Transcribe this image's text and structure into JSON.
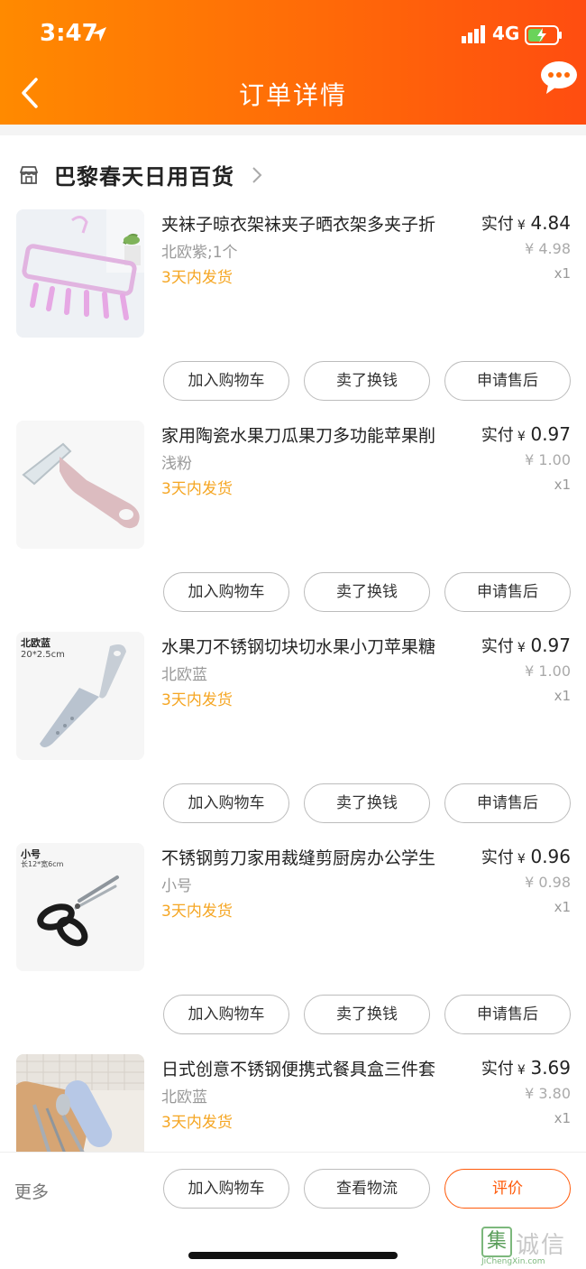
{
  "status_bar": {
    "time": "3:47",
    "network": "4G"
  },
  "header": {
    "title": "订单详情"
  },
  "shop": {
    "name": "巴黎春天日用百货"
  },
  "price_label": "实付",
  "currency": "¥",
  "items": [
    {
      "name": "夹袜子晾衣架袜夹子晒衣架多夹子折",
      "sku": "北欧紫;1个",
      "shipping": "3天内发货",
      "paid": "4.84",
      "original": "4.98",
      "qty": "x1",
      "actions": [
        "加入购物车",
        "卖了换钱",
        "申请售后"
      ]
    },
    {
      "name": "家用陶瓷水果刀瓜果刀多功能苹果削",
      "sku": "浅粉",
      "shipping": "3天内发货",
      "paid": "0.97",
      "original": "1.00",
      "qty": "x1",
      "actions": [
        "加入购物车",
        "卖了换钱",
        "申请售后"
      ]
    },
    {
      "name": "水果刀不锈钢切块切水果小刀苹果糖",
      "sku": "北欧蓝",
      "shipping": "3天内发货",
      "paid": "0.97",
      "original": "1.00",
      "qty": "x1",
      "image_label": "北欧蓝",
      "image_sub": "20*2.5cm",
      "actions": [
        "加入购物车",
        "卖了换钱",
        "申请售后"
      ]
    },
    {
      "name": "不锈钢剪刀家用裁缝剪厨房办公学生",
      "sku": "小号",
      "shipping": "3天内发货",
      "paid": "0.96",
      "original": "0.98",
      "qty": "x1",
      "image_label": "小号",
      "image_sub": "长12*宽6cm",
      "actions": [
        "加入购物车",
        "卖了换钱",
        "申请售后"
      ]
    },
    {
      "name": "日式创意不锈钢便携式餐具盒三件套",
      "sku": "北欧蓝",
      "shipping": "3天内发货",
      "paid": "3.69",
      "original": "3.80",
      "qty": "x1"
    }
  ],
  "bottom_bar": {
    "more": "更多",
    "add_cart": "加入购物车",
    "logistics": "查看物流",
    "review": "评价"
  },
  "watermark": {
    "char": "集",
    "text": "诚信",
    "sub": "JiChengXin.com"
  },
  "colors": {
    "accent": "#ff5a0a",
    "shipping": "#f5a623",
    "header_start": "#ff8a00",
    "header_end": "#ff4d10"
  }
}
